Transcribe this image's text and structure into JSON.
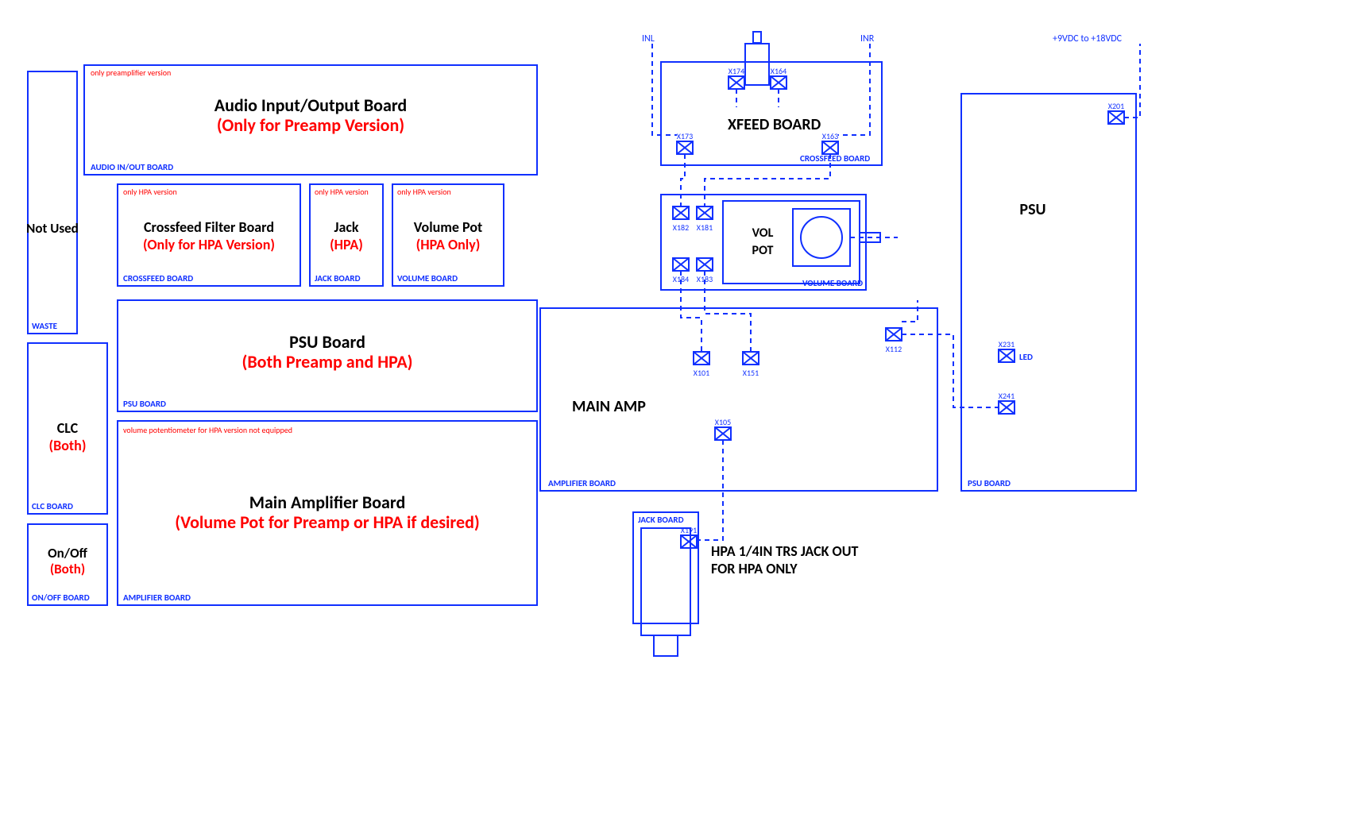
{
  "left": {
    "audio": {
      "note": "only preamplifier version",
      "t1": "Audio Input/Output Board",
      "t2": "(Only for Preamp Version)",
      "label": "AUDIO IN/OUT BOARD"
    },
    "waste": {
      "t1": "Not Used",
      "label": "WASTE"
    },
    "cross": {
      "note": "only HPA version",
      "t1": "Crossfeed Filter Board",
      "t2": "(Only for HPA Version)",
      "label": "CROSSFEED BOARD"
    },
    "jack": {
      "note": "only HPA version",
      "t1": "Jack",
      "t2": "(HPA)",
      "label": "JACK BOARD"
    },
    "vol": {
      "note": "only HPA version",
      "t1": "Volume Pot",
      "t2": "(HPA Only)",
      "label": "VOLUME BOARD"
    },
    "psu": {
      "t1": "PSU Board",
      "t2": "(Both Preamp and HPA)",
      "label": "PSU BOARD"
    },
    "clc": {
      "t1": "CLC",
      "t2": "(Both)",
      "label": "CLC BOARD"
    },
    "amp": {
      "note": "volume potentiometer for HPA version not equipped",
      "t1": "Main Amplifier Board",
      "t2": "(Volume Pot for Preamp or HPA if desired)",
      "label": "AMPLIFIER BOARD"
    },
    "onoff": {
      "t1": "On/Off",
      "t2": "(Both)",
      "label": "ON/OFF BOARD"
    }
  },
  "right": {
    "inl": "INL",
    "inr": "INR",
    "pwr": "+9VDC to +18VDC",
    "xfeed": {
      "title": "XFEED BOARD",
      "label": "CROSSFEED BOARD",
      "x174": "X174",
      "x164": "X164",
      "x173": "X173",
      "x163": "X163"
    },
    "vol": {
      "title1": "VOL",
      "title2": "POT",
      "label": "VOLUME BOARD",
      "x182": "X182",
      "x181": "X181",
      "x184": "X184",
      "x183": "X183"
    },
    "amp": {
      "title": "MAIN AMP",
      "label": "AMPLIFIER BOARD",
      "x101": "X101",
      "x151": "X151",
      "x105": "X105",
      "x112": "X112"
    },
    "psu": {
      "title": "PSU",
      "label": "PSU BOARD",
      "x201": "X201",
      "x231": "X231",
      "x241": "X241",
      "led": "LED"
    },
    "jack": {
      "label": "JACK BOARD",
      "x191": "X191",
      "out1": "HPA 1/4IN TRS JACK OUT",
      "out2": "FOR HPA ONLY"
    }
  }
}
